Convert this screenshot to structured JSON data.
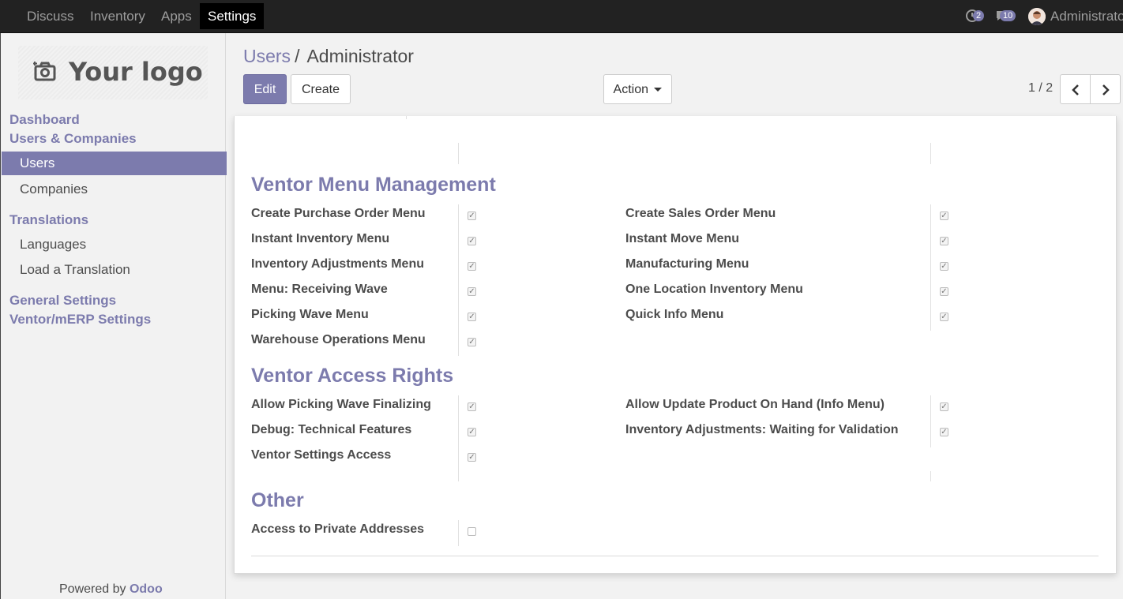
{
  "topbar": {
    "menus": [
      "Discuss",
      "Inventory",
      "Apps",
      "Settings"
    ],
    "activities_count": "2",
    "messages_count": "10",
    "user_name": "Administrator"
  },
  "sidebar": {
    "logo_text": "Your logo",
    "dashboard": "Dashboard",
    "users_companies": "Users & Companies",
    "users": "Users",
    "companies": "Companies",
    "translations": "Translations",
    "languages": "Languages",
    "load_translation": "Load a Translation",
    "general_settings": "General Settings",
    "ventor_settings": "Ventor/mERP Settings",
    "powered_by": "Powered by",
    "odoo": "Odoo"
  },
  "control_panel": {
    "breadcrumb_parent": "Users",
    "breadcrumb_sep": "/",
    "breadcrumb_current": "Administrator",
    "edit_label": "Edit",
    "create_label": "Create",
    "action_label": "Action",
    "pager": "1 / 2"
  },
  "sections": {
    "menu_management": {
      "title": "Ventor Menu Management",
      "left": [
        {
          "label": "Create Purchase Order Menu",
          "checked": true
        },
        {
          "label": "Instant Inventory Menu",
          "checked": true
        },
        {
          "label": "Inventory Adjustments Menu",
          "checked": true
        },
        {
          "label": "Menu: Receiving Wave",
          "checked": true
        },
        {
          "label": "Picking Wave Menu",
          "checked": true
        },
        {
          "label": "Warehouse Operations Menu",
          "checked": true
        }
      ],
      "right": [
        {
          "label": "Create Sales Order Menu",
          "checked": true
        },
        {
          "label": "Instant Move Menu",
          "checked": true
        },
        {
          "label": "Manufacturing Menu",
          "checked": true
        },
        {
          "label": "One Location Inventory Menu",
          "checked": true
        },
        {
          "label": "Quick Info Menu",
          "checked": true
        }
      ]
    },
    "access_rights": {
      "title": "Ventor Access Rights",
      "left": [
        {
          "label": "Allow Picking Wave Finalizing",
          "checked": true
        },
        {
          "label": "Debug: Technical Features",
          "checked": true
        },
        {
          "label": "Ventor Settings Access",
          "checked": true
        }
      ],
      "right": [
        {
          "label": "Allow Update Product On Hand (Info Menu)",
          "checked": true
        },
        {
          "label": "Inventory Adjustments: Waiting for Validation",
          "checked": true
        }
      ]
    },
    "other": {
      "title": "Other",
      "left": [
        {
          "label": "Access to Private Addresses",
          "checked": false
        }
      ]
    }
  },
  "colors": {
    "accent": "#7c7bad",
    "navbar": "#222222"
  }
}
